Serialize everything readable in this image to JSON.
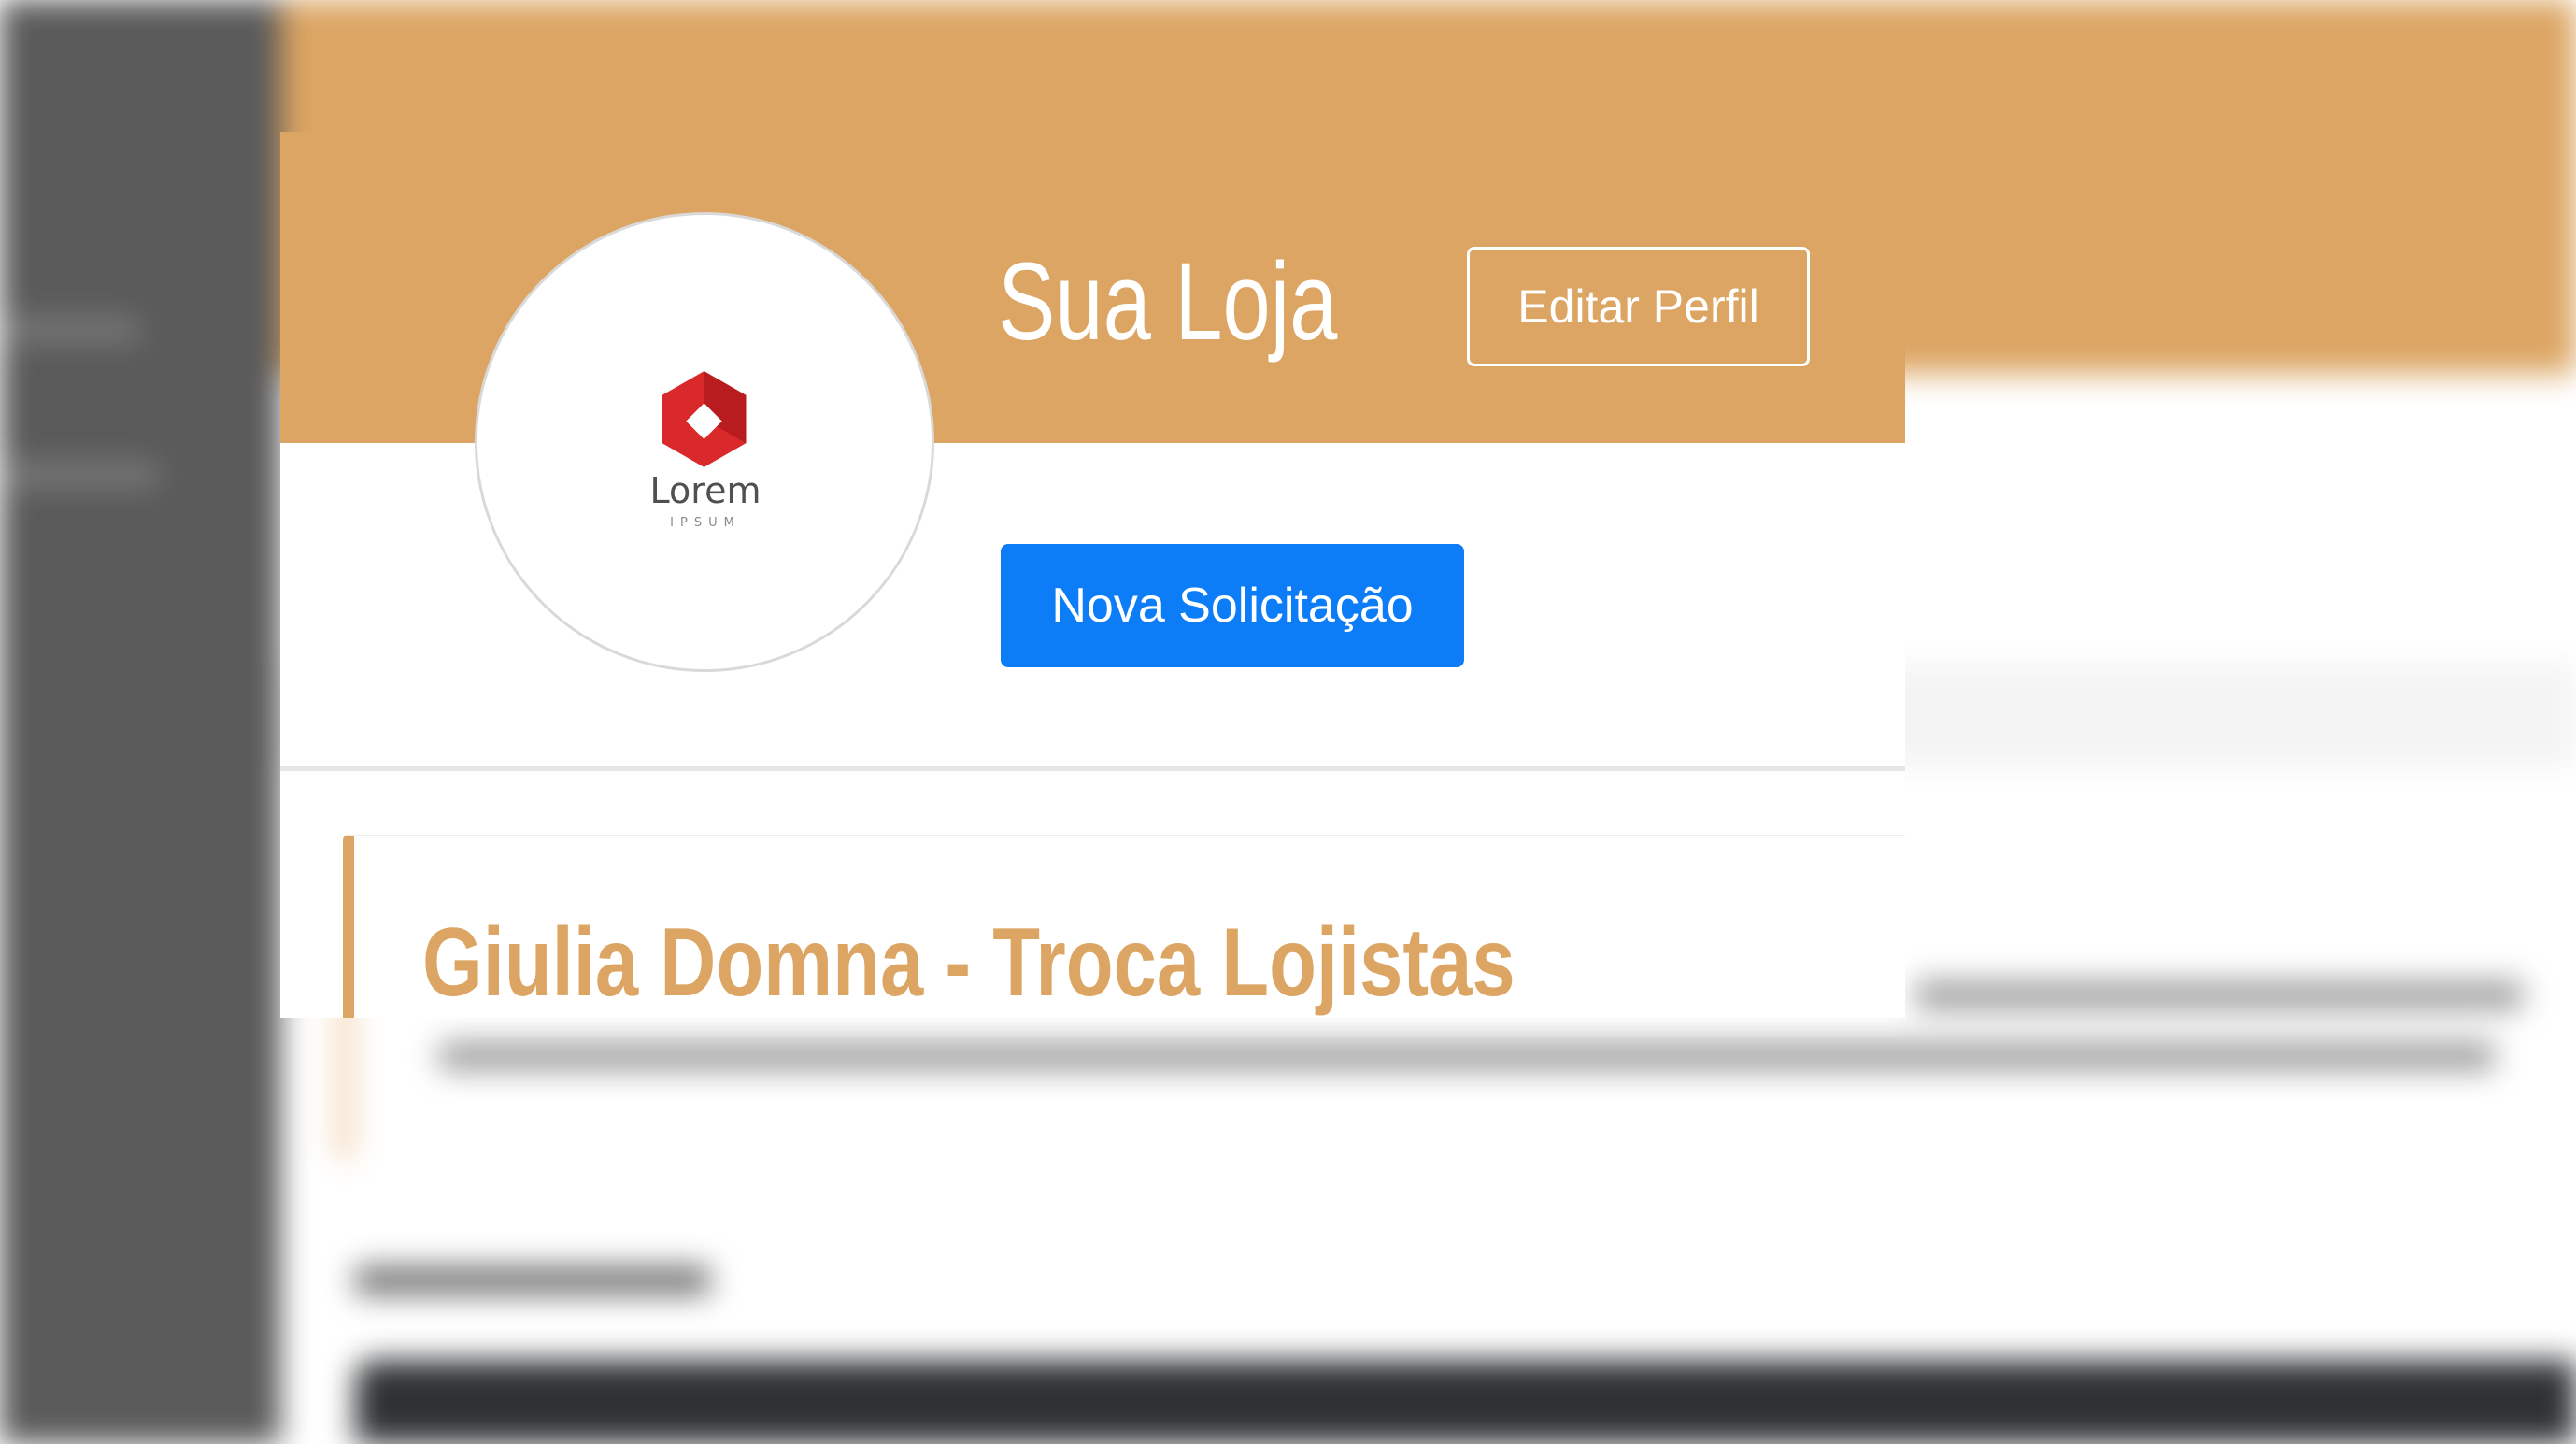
{
  "store_card": {
    "store_name": "Sua Loja",
    "edit_profile_label": "Editar Perfil",
    "new_request_label": "Nova Solicitação",
    "logo_text": "Lorem",
    "logo_subtext": "IPSUM",
    "section_title": "Giulia Domna - Troca Lojistas"
  },
  "colors": {
    "accent": "#dca563",
    "primary_button": "#0d7df7",
    "logo_red": "#d9292a",
    "sidebar": "#5a5a5a"
  },
  "icons": {
    "logo": "lorem-ipsum-logo-icon"
  }
}
